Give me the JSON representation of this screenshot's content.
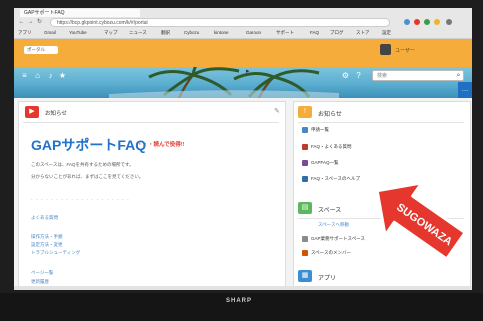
{
  "device": {
    "brand": "SHARP"
  },
  "browser": {
    "tab_title": "GAPサポートFAQ",
    "window_label_left": "ugoki",
    "window_label_right": "",
    "url": "https://bcp.gkpoint.cybozu.com/k/#/portal",
    "bookmarks": [
      "アプリ",
      "Gmail",
      "YouTube",
      "マップ",
      "ニュース",
      "翻訳",
      "Cybozu",
      "kintone",
      "Garoon",
      "サポート",
      "FAQ",
      "ブログ",
      "ストア",
      "設定"
    ]
  },
  "header": {
    "space_selector": "ポータル",
    "user_name": "ユーザー"
  },
  "banner": {
    "search_placeholder": "検索"
  },
  "main": {
    "notice_label": "お知らせ",
    "faq_title": "GAPサポートFAQ",
    "faq_tag": "・・・読んで役得!!",
    "body_lines": [
      "このスペースは、FAQを共有するための場所です。",
      "分からないことがあれば、まずはここを見てください。"
    ],
    "dashes": "- - - - - - - - - - - - - - - - - - - -",
    "links_block1": [
      "よくある質問"
    ],
    "links_block2": [
      "操作方法・手順",
      "設定方法・変更",
      "トラブルシューティング"
    ],
    "links_block3": [
      "ページ一覧",
      "更新履歴"
    ]
  },
  "side": {
    "apps_section_title": "お知らせ",
    "apps_items": [
      "申請一覧",
      "FAQ・よくある質問",
      "GAPFAQ一覧",
      "FAQ・スペースのヘルプ"
    ],
    "space_section_title": "スペース",
    "space_link": "スペースへ移動",
    "space_items": [
      "GAP業務サポートスペース",
      "スペースのメンバー"
    ],
    "app_section_title": "アプリ"
  },
  "annotation": {
    "label": "SUGOWAZA"
  },
  "colors": {
    "orange": "#f5ac3a",
    "accent_blue": "#1f73c8",
    "accent_red": "#e5372d"
  }
}
